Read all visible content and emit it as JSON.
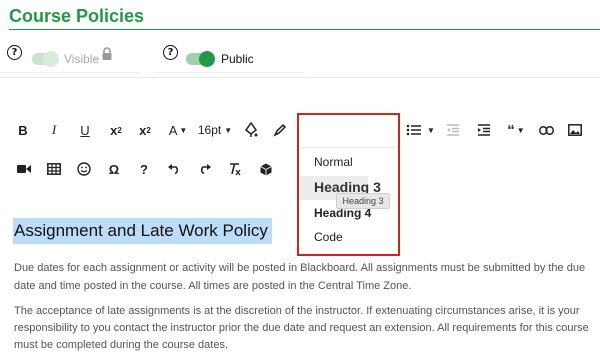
{
  "page": {
    "title": "Course Policies",
    "accent": "#1e9a43"
  },
  "settings": {
    "visible_label": "Visible",
    "public_label": "Public",
    "help_glyph": "?"
  },
  "toolbar": {
    "font_size": "16pt",
    "row1": [
      "B",
      "I",
      "U",
      "subscript",
      "superscript",
      "font-color",
      "font-size",
      "paint-format",
      "highlight",
      "paragraph-format",
      "align",
      "ordered-list",
      "unordered-list",
      "outdent",
      "indent",
      "quote",
      "link",
      "image"
    ],
    "row2": [
      "video",
      "table",
      "emoji",
      "special-character",
      "help",
      "undo",
      "redo",
      "clear-formatting",
      "code-view"
    ]
  },
  "paragraph_menu": {
    "items": [
      "Normal",
      "Heading 3",
      "Heading 4",
      "Code"
    ],
    "hovered": "Heading 3",
    "tooltip": "Heading 3",
    "highlight_color": "#c6281e"
  },
  "content": {
    "heading": "Assignment and Late Work Policy",
    "para1_line1": "Due dates for each assignment or activity will be posted in Blackboard. All assignments must be submitted by the due",
    "para1_line2": "date and time posted in the course. All times are posted in the Central Time Zone.",
    "para2_line1": "The acceptance of late assignments is at the discretion of the instructor. If extenuating circumstances arise, it is your",
    "para2_line2": "responsibility to you contact the instructor prior the due date and request an extension. All requirements for this course",
    "para2_line3": "must be completed during the course dates."
  }
}
